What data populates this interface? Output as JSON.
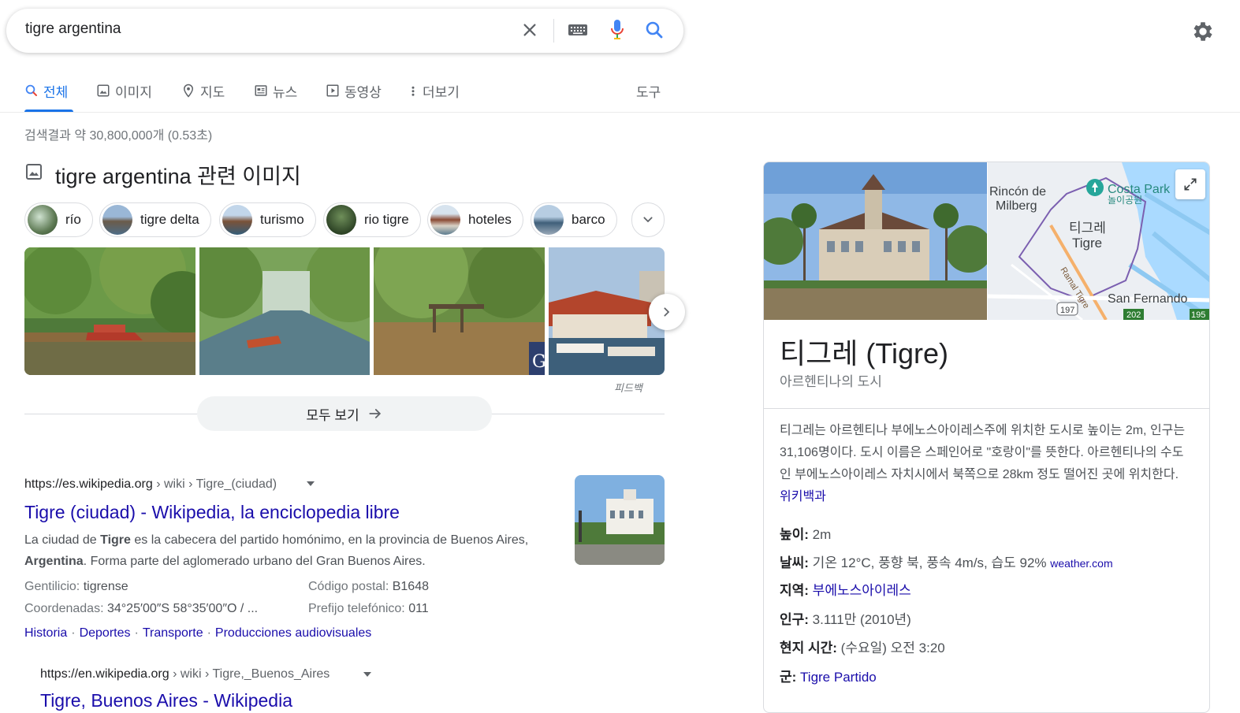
{
  "search": {
    "query": "tigre argentina"
  },
  "tabs": [
    {
      "label": "전체",
      "icon": "search-icon",
      "active": true
    },
    {
      "label": "이미지",
      "icon": "image-icon"
    },
    {
      "label": "지도",
      "icon": "map-pin-icon"
    },
    {
      "label": "뉴스",
      "icon": "news-icon"
    },
    {
      "label": "동영상",
      "icon": "video-icon"
    },
    {
      "label": "더보기",
      "icon": "more-vert-icon"
    }
  ],
  "tools_label": "도구",
  "result_stats": "검색결과 약 30,800,000개 (0.53초)",
  "images": {
    "heading": "tigre argentina 관련 이미지",
    "chips": [
      "río",
      "tigre delta",
      "turismo",
      "rio tigre",
      "hoteles",
      "barco"
    ],
    "feedback": "피드백",
    "see_all": "모두 보기"
  },
  "results": [
    {
      "domain": "https://es.wikipedia.org",
      "path": " › wiki › Tigre_(ciudad)",
      "title": "Tigre (ciudad) - Wikipedia, la enciclopedia libre",
      "snippet": {
        "p1": "La ciudad de ",
        "b1": "Tigre",
        "p2": " es la cabecera del partido homónimo, en la provincia de Buenos Aires, ",
        "b2": "Argentina",
        "p3": ". Forma parte del aglomerado urbano del Gran Buenos Aires."
      },
      "attributes": [
        {
          "label": "Gentilicio: ",
          "value": "tigrense"
        },
        {
          "label": "Código postal: ",
          "value": "B1648"
        },
        {
          "label": "Coordenadas: ",
          "value": "34°25′00″S 58°35′00″O / ..."
        },
        {
          "label": "Prefijo telefónico: ",
          "value": "011"
        }
      ],
      "sitelinks": [
        "Historia",
        "Deportes",
        "Transporte",
        "Producciones audiovisuales"
      ]
    },
    {
      "domain": "https://en.wikipedia.org",
      "path": " › wiki › Tigre,_Buenos_Aires",
      "title": "Tigre, Buenos Aires - Wikipedia"
    }
  ],
  "knowledge_panel": {
    "title": "티그레 (Tigre)",
    "subtitle": "아르헨티나의 도시",
    "description": "티그레는 아르헨티나 부에노스아이레스주에 위치한 도시로 높이는 2m, 인구는 31,106명이다. 도시 이름은 스페인어로 \"호랑이\"를 뜻한다. 아르헨티나의 수도인 부에노스아이레스 자치시에서 북쪽으로 28km 정도 떨어진 곳에 위치한다. ",
    "description_source": "위키백과",
    "map_labels": {
      "rincon1": "Rincón de",
      "rincon2": "Milberg",
      "costa": "Costa Park",
      "costa_kr": "놀이공원",
      "tigre_kr": "티그레",
      "tigre": "Tigre",
      "ramal": "Ramal Tigre",
      "san_fernando": "San Fernando",
      "route197": "197",
      "route202": "202",
      "route195": "195"
    },
    "facts": [
      {
        "key": "높이:",
        "value": " 2m"
      },
      {
        "key": "날씨:",
        "value": " 기온 12°C, 풍향 북, 풍속 4m/s, 습도 92% ",
        "source": "weather.com"
      },
      {
        "key": "지역:",
        "link": " 부에노스아이레스"
      },
      {
        "key": "인구:",
        "value": " 3.111만 (2010년)"
      },
      {
        "key": "현지 시간:",
        "value": " (수요일) 오전 3:20"
      },
      {
        "key": "군:",
        "link": " Tigre Partido"
      }
    ]
  },
  "colors": {
    "link": "#1a0dab",
    "accent": "#1a73e8",
    "text": "#202124",
    "muted": "#70757a"
  }
}
